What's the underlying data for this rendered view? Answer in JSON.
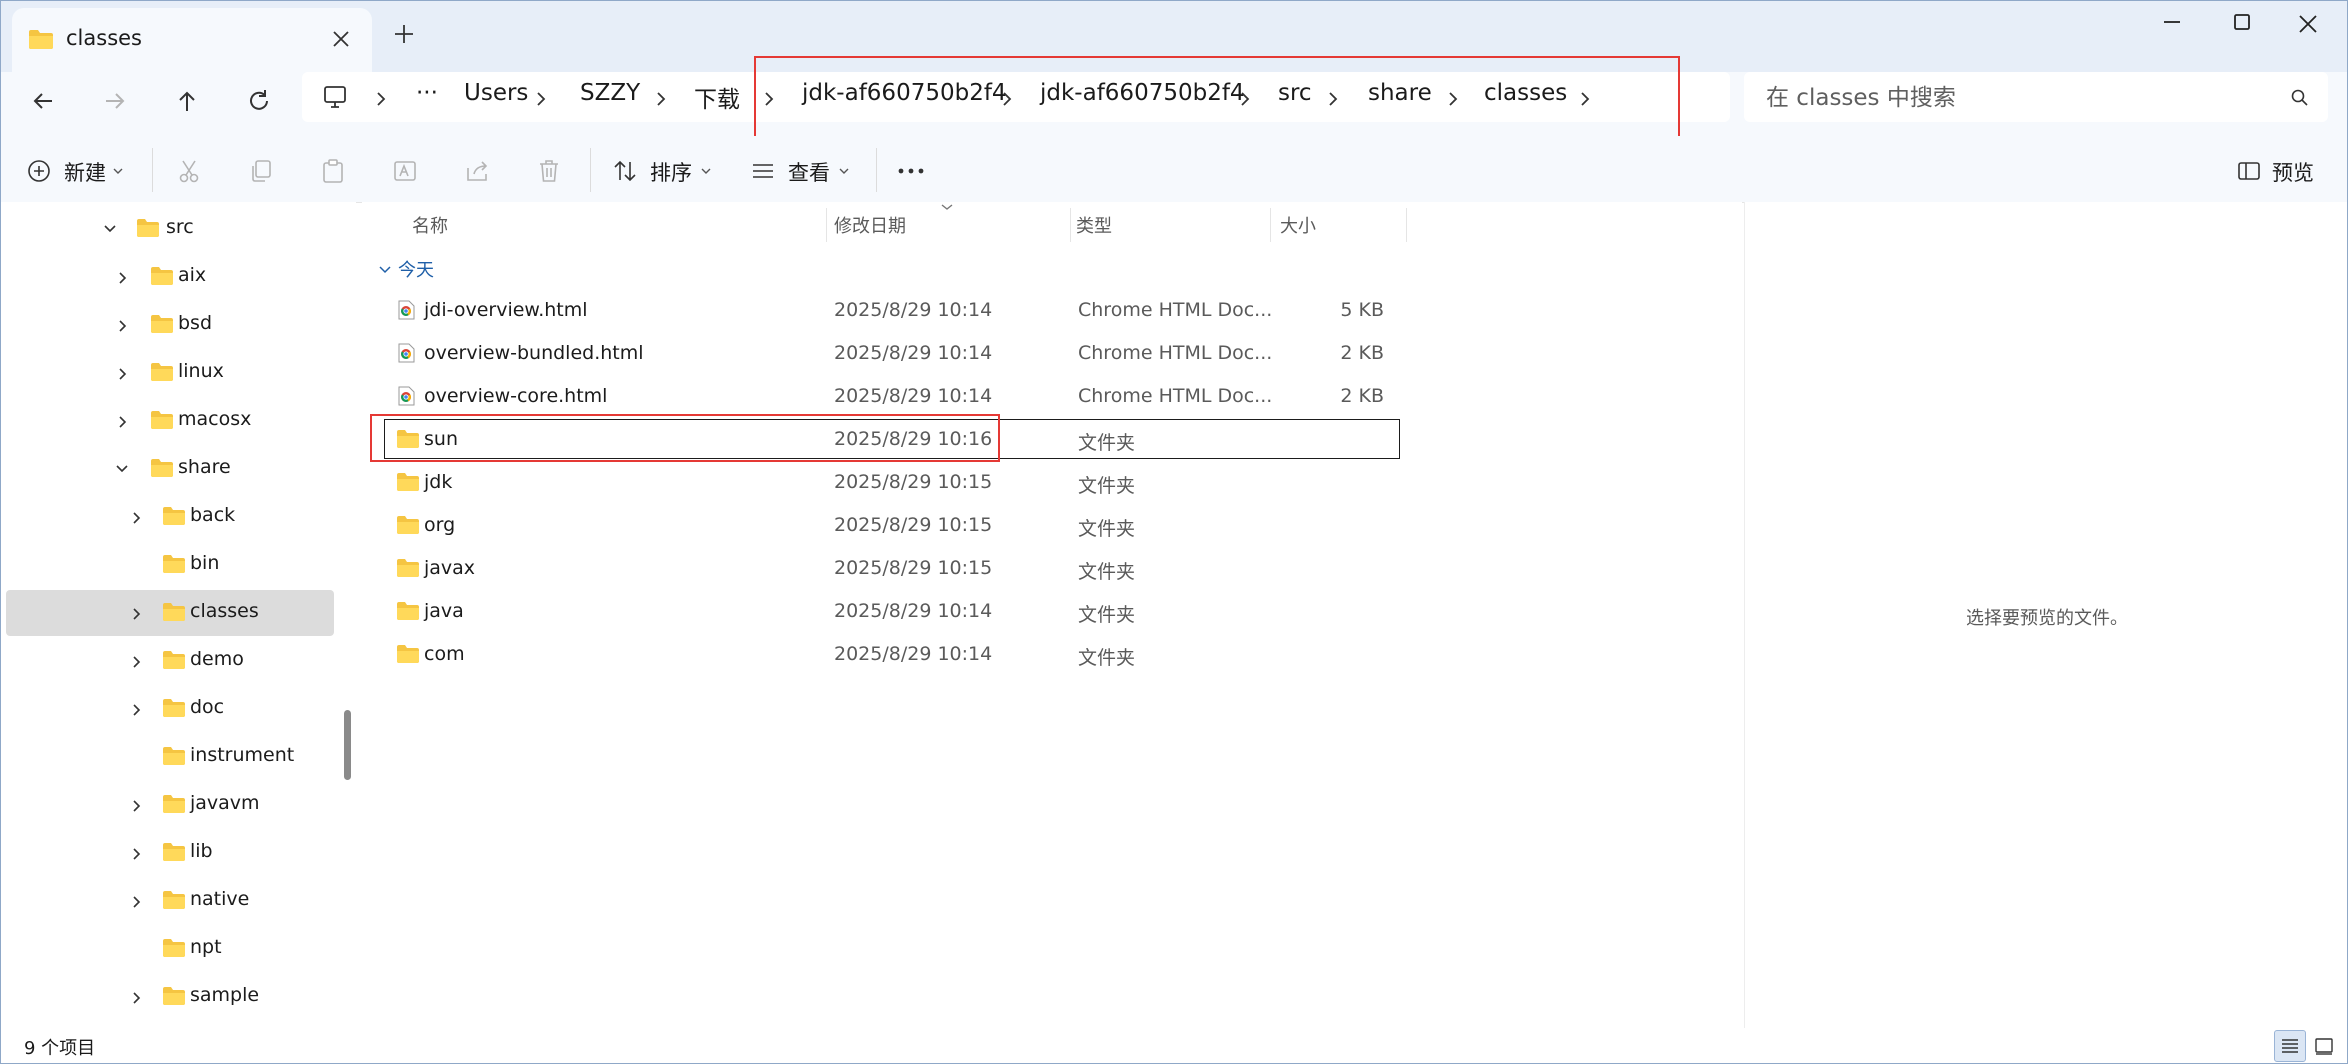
{
  "window": {
    "tab_title": "classes"
  },
  "breadcrumb": [
    "Users",
    "SZZY",
    "下载",
    "jdk-af660750b2f4",
    "jdk-af660750b2f4",
    "src",
    "share",
    "classes"
  ],
  "breadcrumb_overflow": "···",
  "search": {
    "placeholder": "在 classes 中搜索"
  },
  "toolbar": {
    "new_label": "新建",
    "sort_label": "排序",
    "view_label": "查看",
    "preview_label": "预览"
  },
  "sidebar": {
    "items": [
      {
        "label": "src",
        "expanded": true
      },
      {
        "label": "aix"
      },
      {
        "label": "bsd"
      },
      {
        "label": "linux"
      },
      {
        "label": "macosx"
      },
      {
        "label": "share",
        "expanded": true
      },
      {
        "label": "back"
      },
      {
        "label": "bin"
      },
      {
        "label": "classes",
        "selected": true
      },
      {
        "label": "demo"
      },
      {
        "label": "doc"
      },
      {
        "label": "instrument"
      },
      {
        "label": "javavm"
      },
      {
        "label": "lib"
      },
      {
        "label": "native"
      },
      {
        "label": "npt"
      },
      {
        "label": "sample"
      }
    ]
  },
  "filelist": {
    "columns": {
      "name": "名称",
      "date": "修改日期",
      "type": "类型",
      "size": "大小"
    },
    "group_label": "今天",
    "rows": [
      {
        "name": "jdi-overview.html",
        "date": "2025/8/29 10:14",
        "type": "Chrome HTML Doc...",
        "size": "5 KB",
        "icon": "chrome-html-icon"
      },
      {
        "name": "overview-bundled.html",
        "date": "2025/8/29 10:14",
        "type": "Chrome HTML Doc...",
        "size": "2 KB",
        "icon": "chrome-html-icon"
      },
      {
        "name": "overview-core.html",
        "date": "2025/8/29 10:14",
        "type": "Chrome HTML Doc...",
        "size": "2 KB",
        "icon": "chrome-html-icon"
      },
      {
        "name": "sun",
        "date": "2025/8/29 10:16",
        "type": "文件夹",
        "size": "",
        "icon": "folder-icon",
        "focused": true
      },
      {
        "name": "jdk",
        "date": "2025/8/29 10:15",
        "type": "文件夹",
        "size": "",
        "icon": "folder-icon"
      },
      {
        "name": "org",
        "date": "2025/8/29 10:15",
        "type": "文件夹",
        "size": "",
        "icon": "folder-icon"
      },
      {
        "name": "javax",
        "date": "2025/8/29 10:15",
        "type": "文件夹",
        "size": "",
        "icon": "folder-icon"
      },
      {
        "name": "java",
        "date": "2025/8/29 10:14",
        "type": "文件夹",
        "size": "",
        "icon": "folder-icon"
      },
      {
        "name": "com",
        "date": "2025/8/29 10:14",
        "type": "文件夹",
        "size": "",
        "icon": "folder-icon"
      }
    ]
  },
  "preview": {
    "empty_text": "选择要预览的文件。"
  },
  "status": {
    "item_count": "9 个项目"
  },
  "colors": {
    "accent": "#1f5fa8",
    "folder": "#f5c542",
    "annotation": "#e53935",
    "titlebar": "#e7eef8"
  }
}
